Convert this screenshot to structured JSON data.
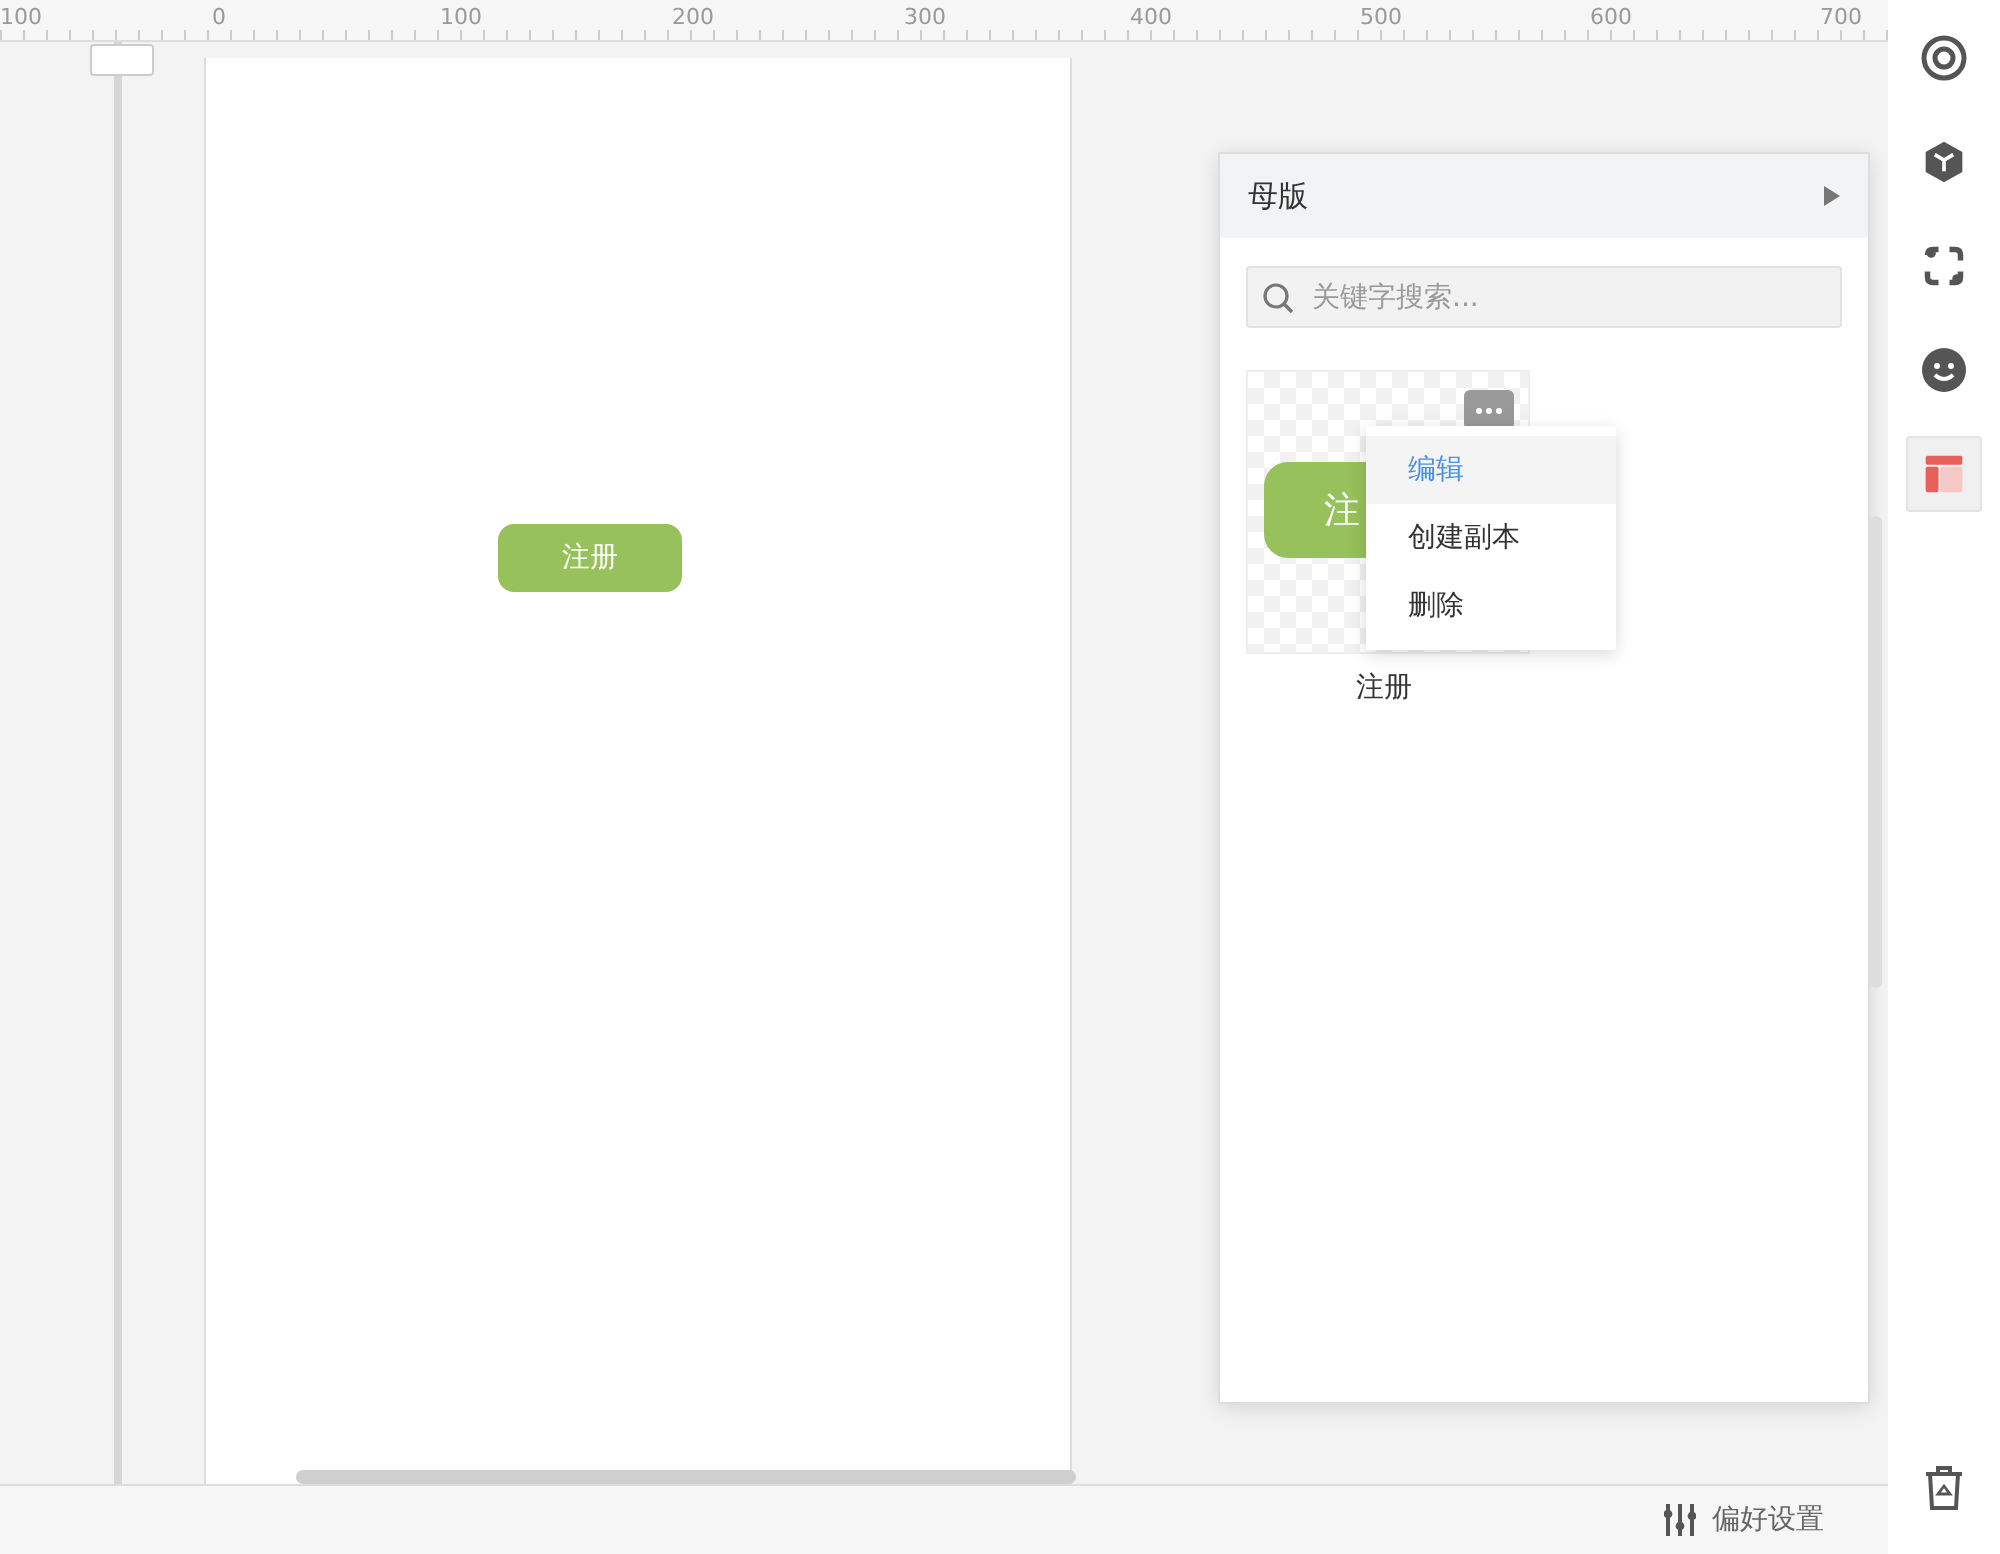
{
  "ruler": {
    "labels": [
      "100",
      "0",
      "100",
      "200",
      "300",
      "400",
      "500",
      "600",
      "700"
    ]
  },
  "canvas": {
    "button": "注册"
  },
  "panel": {
    "title": "母版",
    "search": {
      "placeholder": "关键字搜索..."
    },
    "masters": [
      {
        "thumb_text": "注",
        "label": "注册"
      }
    ],
    "menu": [
      {
        "label": "编辑",
        "selected": true
      },
      {
        "label": "创建副本",
        "selected": false
      },
      {
        "label": "删除",
        "selected": false
      }
    ]
  },
  "toolbar": [
    {
      "kind": "target",
      "selected": false
    },
    {
      "kind": "cube",
      "selected": false
    },
    {
      "kind": "frame",
      "selected": false
    },
    {
      "kind": "face",
      "selected": false
    },
    {
      "kind": "layout",
      "selected": true
    }
  ],
  "status": {
    "settings": "偏好设置"
  }
}
